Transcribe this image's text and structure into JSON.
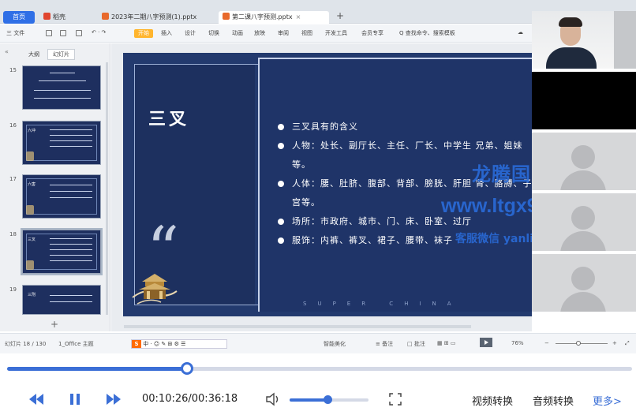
{
  "tabs": {
    "home": "首页",
    "tab1": "稻壳",
    "tab2": "2023年二期八字预测(1).pptx",
    "tab3": "第二课八字预测.pptx",
    "close": "×",
    "new_tab": "+"
  },
  "ribbon": {
    "file": "三 文件",
    "start": "开始",
    "items": [
      "插入",
      "设计",
      "切换",
      "动画",
      "放映",
      "审阅",
      "视图",
      "开发工具",
      "会员专享"
    ],
    "search": "Q 查找命令、搜索模板"
  },
  "sidebar": {
    "tab_outline": "大纲",
    "tab_slides": "幻灯片",
    "slides": [
      {
        "num": "15",
        "title": "",
        "selected": false
      },
      {
        "num": "16",
        "title": "六冲",
        "selected": false
      },
      {
        "num": "17",
        "title": "六害",
        "selected": false
      },
      {
        "num": "18",
        "title": "三叉",
        "selected": true
      },
      {
        "num": "19",
        "title": "三刑",
        "selected": false
      }
    ],
    "add": "+"
  },
  "slide": {
    "title": "三叉",
    "quote": "“",
    "bullets": [
      "三叉具有的含义",
      "人物：处长、副厅长、主任、厂长、中学生 兄弟、姐妹等。",
      "人体：腰、肚脐、腹部、背部、膀胱、肝胆 肾、胳膊、子宫等。",
      "场所：市政府、城市、门、床、卧室、过厅",
      "服饰：内裤、裤叉、裙子、腰带、袜子"
    ],
    "footer": "SUPER CHINA"
  },
  "watermark": {
    "line1": "龙腾国学网",
    "line2": "www.ltgx99.com",
    "line3": "客服微信 yanliaofan225"
  },
  "statusbar": {
    "slide_counter": "幻灯片 18 / 130",
    "theme": "1_Office 主题",
    "ime_text": "中 · ☺ ✎ ⊞ ⚙ ☰",
    "smart": "智能美化",
    "notes": "≡ 备注",
    "comment": "□ 批注",
    "zoom": "76%"
  },
  "player": {
    "progress": 0.288,
    "volume": 0.48,
    "time": "00:10:26/00:36:18",
    "video_convert": "视频转换",
    "audio_convert": "音频转换",
    "more": "更多>"
  }
}
